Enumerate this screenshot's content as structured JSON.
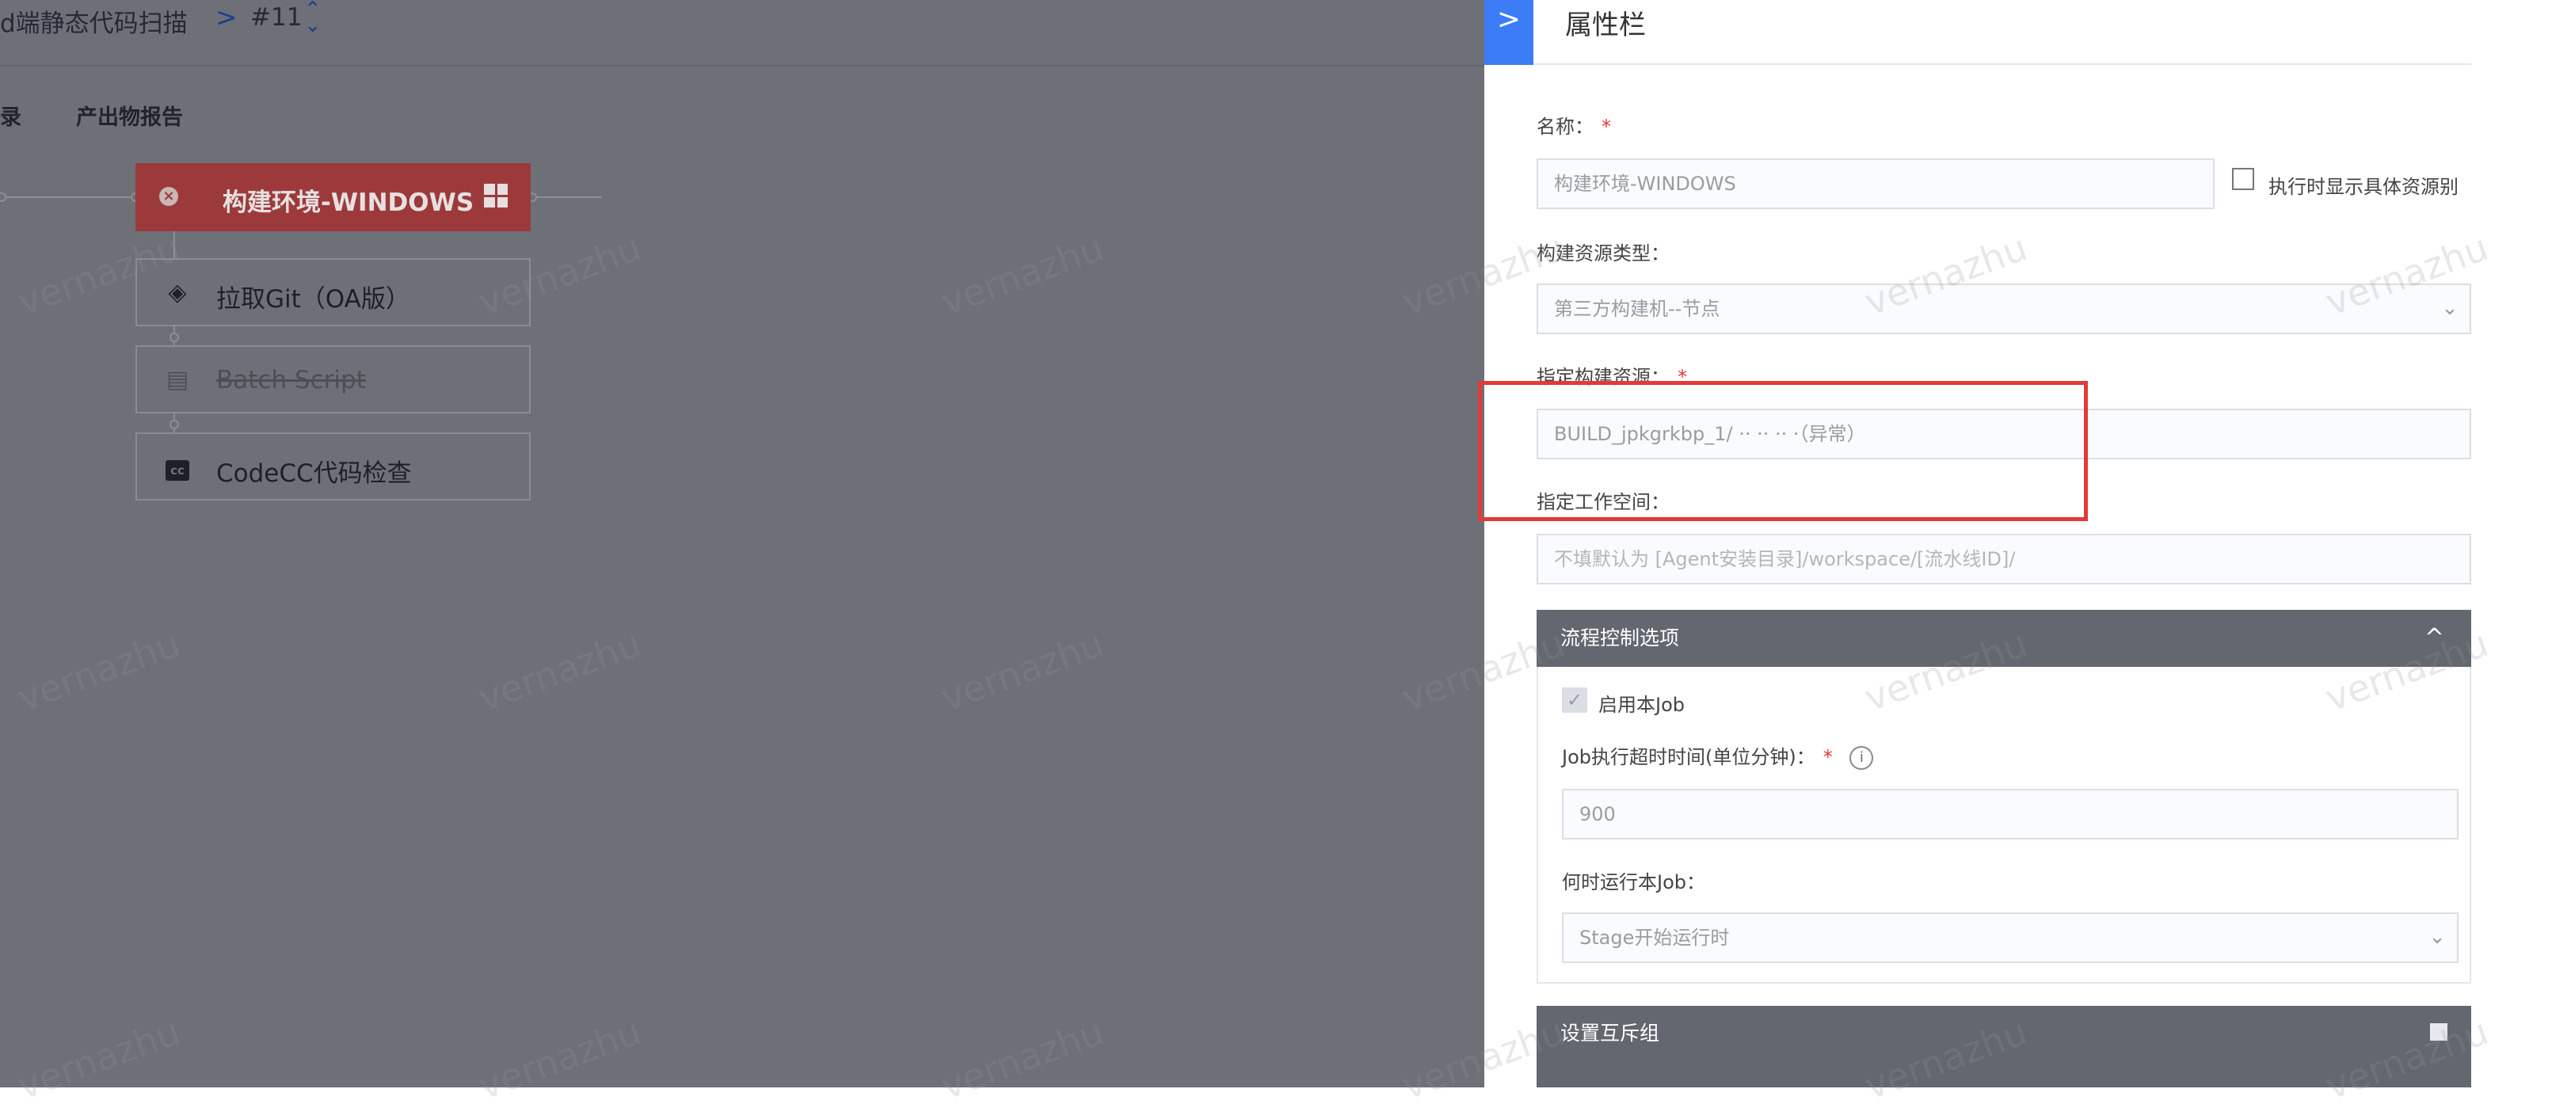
{
  "breadcrumb": {
    "pipeline_name": "d端静态代码扫描",
    "separator": ">",
    "build_number": "#11",
    "switch_icon": "chevron-updown-icon"
  },
  "subtabs": {
    "records": "录",
    "report": "产出物报告"
  },
  "pipeline": {
    "job_title": "构建环境-WINDOWS",
    "job_status_icon": "close-circle-icon",
    "job_os_icon": "windows-icon",
    "atoms": [
      {
        "label": "拉取Git（OA版）",
        "icon": "git-diamond-icon",
        "disabled": false
      },
      {
        "label": "Batch Script",
        "icon": "clipboard-icon",
        "disabled": true
      },
      {
        "label": "CodeCC代码检查",
        "icon": "codecc-icon",
        "icon_text": "cc",
        "disabled": false
      }
    ]
  },
  "panel": {
    "toggle_glyph": ">",
    "title": "属性栏",
    "name_label": "名称：",
    "required_mark": "*",
    "name_value": "构建环境-WINDOWS",
    "show_resource_alias_label": "执行时显示具体资源别",
    "resource_type_label": "构建资源类型：",
    "resource_type_value": "第三方构建机--节点",
    "resource_label": "指定构建资源：",
    "resource_value": "BUILD_jpkgrkbp_1/ ·· ·· ·· ·（异常）",
    "workspace_label": "指定工作空间：",
    "workspace_placeholder": "不填默认为 [Agent安装目录]/workspace/[流水线ID]/",
    "flow_control": {
      "title": "流程控制选项",
      "collapse_glyph": "^",
      "enable_job_label": "启用本Job",
      "enable_job_checked": true,
      "timeout_label": "Job执行超时时间(单位分钟)：",
      "timeout_value": "900",
      "info_glyph": "i",
      "run_when_label": "何时运行本Job：",
      "run_when_value": "Stage开始运行时"
    },
    "mutex_group_title": "设置互斥组"
  },
  "watermark_text": "vernazhu",
  "colors": {
    "accent_blue": "#3c7cf6",
    "error_red": "#e23a3a",
    "section_gray": "#63676f",
    "overlay_gray": "#6e7078"
  }
}
